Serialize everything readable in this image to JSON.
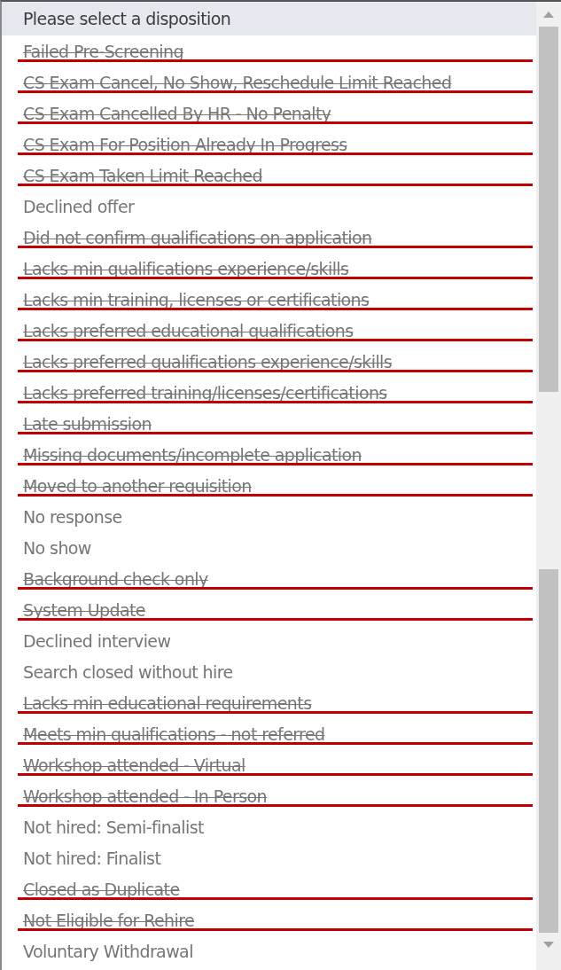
{
  "options": [
    {
      "label": "Please select a disposition",
      "selected": true,
      "struck": false
    },
    {
      "label": "Failed Pre-Screening",
      "selected": false,
      "struck": true
    },
    {
      "label": "CS Exam Cancel, No Show, Reschedule Limit Reached",
      "selected": false,
      "struck": true
    },
    {
      "label": "CS Exam Cancelled By HR - No Penalty",
      "selected": false,
      "struck": true
    },
    {
      "label": "CS Exam For Position Already In Progress",
      "selected": false,
      "struck": true
    },
    {
      "label": "CS Exam Taken Limit Reached",
      "selected": false,
      "struck": true
    },
    {
      "label": "Declined offer",
      "selected": false,
      "struck": false
    },
    {
      "label": "Did not confirm qualifications on application",
      "selected": false,
      "struck": true
    },
    {
      "label": "Lacks min qualifications experience/skills",
      "selected": false,
      "struck": true
    },
    {
      "label": "Lacks min training, licenses or certifications",
      "selected": false,
      "struck": true
    },
    {
      "label": "Lacks preferred educational qualifications",
      "selected": false,
      "struck": true
    },
    {
      "label": "Lacks preferred qualifications experience/skills",
      "selected": false,
      "struck": true
    },
    {
      "label": "Lacks preferred training/licenses/certifications",
      "selected": false,
      "struck": true
    },
    {
      "label": "Late submission",
      "selected": false,
      "struck": true
    },
    {
      "label": "Missing documents/incomplete application",
      "selected": false,
      "struck": true
    },
    {
      "label": "Moved to another requisition",
      "selected": false,
      "struck": true
    },
    {
      "label": "No response",
      "selected": false,
      "struck": false
    },
    {
      "label": "No show",
      "selected": false,
      "struck": false
    },
    {
      "label": "Background check only",
      "selected": false,
      "struck": true
    },
    {
      "label": "System Update",
      "selected": false,
      "struck": true
    },
    {
      "label": "Declined interview",
      "selected": false,
      "struck": false
    },
    {
      "label": "Search closed without hire",
      "selected": false,
      "struck": false
    },
    {
      "label": "Lacks min educational requirements",
      "selected": false,
      "struck": true
    },
    {
      "label": "Meets min qualifications - not referred",
      "selected": false,
      "struck": true
    },
    {
      "label": "Workshop attended - Virtual",
      "selected": false,
      "struck": true
    },
    {
      "label": "Workshop attended - In Person",
      "selected": false,
      "struck": true
    },
    {
      "label": "Not hired: Semi-finalist",
      "selected": false,
      "struck": false
    },
    {
      "label": "Not hired: Finalist",
      "selected": false,
      "struck": false
    },
    {
      "label": "Closed as Duplicate",
      "selected": false,
      "struck": true
    },
    {
      "label": "Not Eligible for Rehire",
      "selected": false,
      "struck": true
    },
    {
      "label": "Voluntary Withdrawal",
      "selected": false,
      "struck": false
    }
  ]
}
